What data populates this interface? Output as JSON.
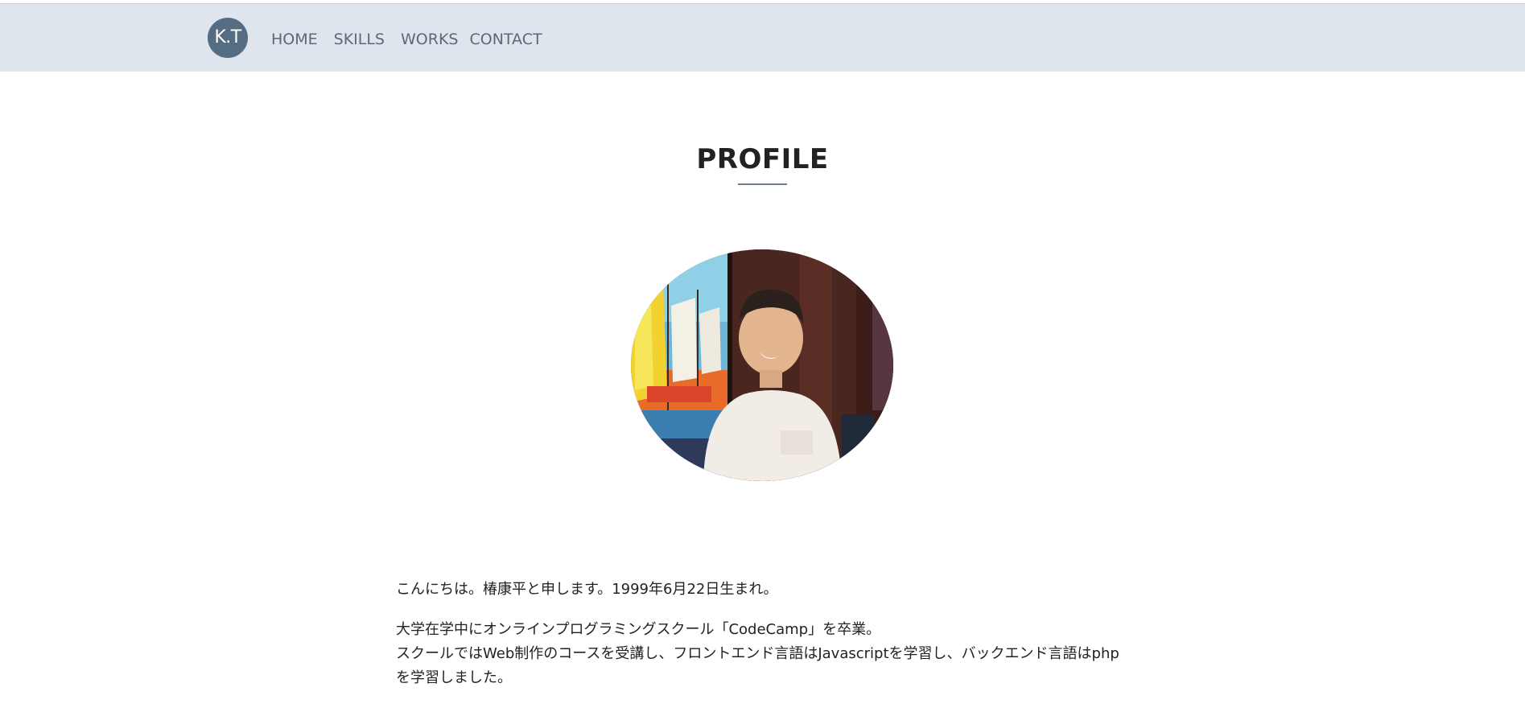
{
  "header": {
    "logo_text": "K.T",
    "nav": [
      {
        "label": "HOME"
      },
      {
        "label": "SKILLS"
      },
      {
        "label": "WORKS"
      },
      {
        "label": "CONTACT"
      }
    ],
    "background_color": "#dee5ed",
    "logo_color": "#546d82"
  },
  "main": {
    "title": "PROFILE",
    "photo_icon": "profile-photo",
    "paragraphs": [
      "こんにちは。椿康平と申します。1999年6月22日生まれ。",
      "大学在学中にオンラインプログラミングスクール「CodeCamp」を卒業。",
      "スクールではWeb制作のコースを受講し、フロントエンド言語はJavascriptを学習し、バックエンド言語はphpを学習しました。"
    ]
  }
}
